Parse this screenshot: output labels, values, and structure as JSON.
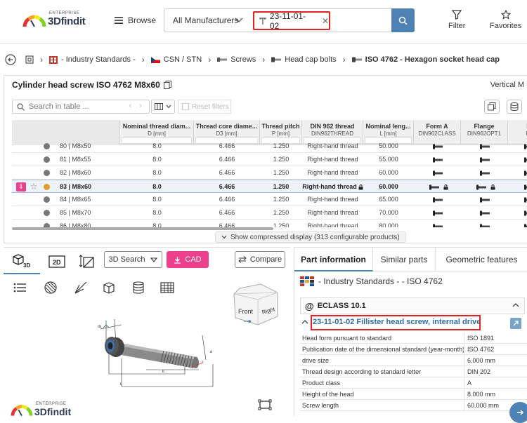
{
  "topbar": {
    "logo_sup": "ENTERPRISE",
    "logo_main": "3Dfindit",
    "browse_label": "Browse",
    "manufacturer_select": "All Manufacturers",
    "search_chip": "23-11-01-02",
    "filter_label": "Filter",
    "favorites_label": "Favorites"
  },
  "breadcrumb": [
    {
      "label": "- Industry Standards -"
    },
    {
      "label": "CSN / STN"
    },
    {
      "label": "Screws"
    },
    {
      "label": "Head cap bolts"
    },
    {
      "label": "ISO 4762 - Hexagon socket head cap"
    }
  ],
  "table_panel": {
    "title": "Cylinder head screw ISO 4762 M8x60",
    "view_mode": "Vertical M",
    "search_placeholder": "Search in table ...",
    "reset_filters": "Reset filters",
    "compressed_label": "Show compressed display (313 configurable products)",
    "columns": [
      {
        "title": "Nominal thread diam...",
        "sub": "D [mm]"
      },
      {
        "title": "Thread core diame...",
        "sub": "D3 [mm]"
      },
      {
        "title": "Thread pitch",
        "sub": "P [mm]"
      },
      {
        "title": "DIN 962 thread",
        "sub": "DIN962THREAD"
      },
      {
        "title": "Nominal leng...",
        "sub": "L [mm]"
      },
      {
        "title": "Form A",
        "sub": "DIN962CLASS"
      },
      {
        "title": "Flange",
        "sub": "DIN962OPT1"
      },
      {
        "title": "H",
        "sub": "DI"
      }
    ],
    "rows": [
      {
        "id": "80 | M8x50",
        "d": "8.0",
        "d3": "6.466",
        "p": "1.250",
        "thread": "Right-hand thread",
        "l": "50.000"
      },
      {
        "id": "81 | M8x55",
        "d": "8.0",
        "d3": "6.466",
        "p": "1.250",
        "thread": "Right-hand thread",
        "l": "55.000"
      },
      {
        "id": "82 | M8x60",
        "d": "8.0",
        "d3": "6.466",
        "p": "1.250",
        "thread": "Right-hand thread",
        "l": "60.000"
      },
      {
        "id": "83 | M8x60",
        "d": "8.0",
        "d3": "6.466",
        "p": "1.250",
        "thread": "Right-hand thread",
        "l": "60.000",
        "selected": true
      },
      {
        "id": "84 | M8x65",
        "d": "8.0",
        "d3": "6.466",
        "p": "1.250",
        "thread": "Right-hand thread",
        "l": "65.000"
      },
      {
        "id": "85 | M8x70",
        "d": "8.0",
        "d3": "6.466",
        "p": "1.250",
        "thread": "Right-hand thread",
        "l": "70.000"
      },
      {
        "id": "86 | M8x80",
        "d": "8.0",
        "d3": "6.466",
        "p": "1.250",
        "thread": "Right-hand thread",
        "l": "80.000"
      }
    ]
  },
  "viewer": {
    "tab_3d": "3D",
    "tab_2d": "2D",
    "search3d_label": "3D Search",
    "cad_label": "CAD",
    "compare_label": "Compare",
    "cube_front": "Front",
    "cube_right": "Right",
    "logo_sup": "ENTERPRISE",
    "logo_main": "3Dfindit"
  },
  "right_panel": {
    "tabs": [
      "Part information",
      "Similar parts",
      "Geometric features"
    ],
    "catalog_line": "- Industry Standards - - ISO 4762",
    "eclass_label": "ECLASS 10.1",
    "eclass_title": "23-11-01-02 Fillister head screw, internal drive",
    "properties": [
      {
        "key": "Head form pursuant to standard",
        "value": "ISO 1891"
      },
      {
        "key": "Publication date of the dimensional standard (year-month)",
        "value": "ISO 4762"
      },
      {
        "key": "drive size",
        "value": "6.000 mm"
      },
      {
        "key": "Thread design according to standard letter",
        "value": "DIN 202"
      },
      {
        "key": "Product class",
        "value": "A"
      },
      {
        "key": "Height of the head",
        "value": "8.000 mm"
      },
      {
        "key": "Screw length",
        "value": "60.000 mm"
      }
    ]
  },
  "colors": {
    "accent": "#4f82b4",
    "highlight_red": "#e32222",
    "cad_pink": "#ec3f8c",
    "link_blue": "#2e6da4"
  }
}
